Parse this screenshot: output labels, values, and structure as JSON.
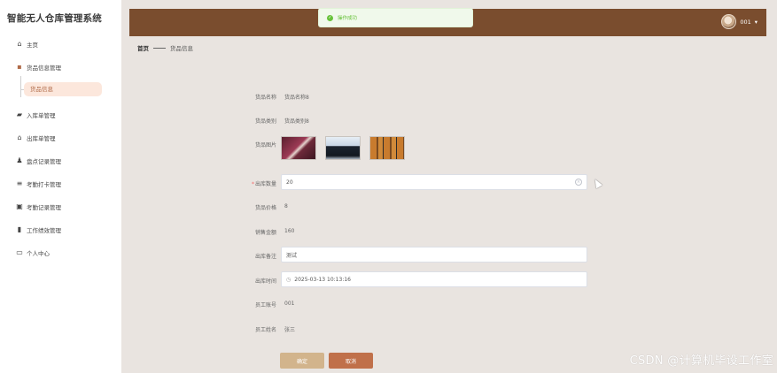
{
  "app": {
    "title": "智能无人仓库管理系统"
  },
  "sidebar": {
    "items": [
      {
        "label": "主页",
        "icon": "home-icon"
      },
      {
        "label": "货品信息管理",
        "icon": "grid-icon"
      },
      {
        "label": "货品信息",
        "icon": "",
        "active": true
      },
      {
        "label": "入库单管理",
        "icon": "truck-icon"
      },
      {
        "label": "出库单管理",
        "icon": "warehouse-icon"
      },
      {
        "label": "盘点记录管理",
        "icon": "person-icon"
      },
      {
        "label": "考勤打卡管理",
        "icon": "list-icon"
      },
      {
        "label": "考勤记录管理",
        "icon": "checkbox-icon"
      },
      {
        "label": "工作绩效管理",
        "icon": "chart-icon"
      },
      {
        "label": "个人中心",
        "icon": "card-icon"
      }
    ]
  },
  "topbar": {
    "toast": "操作成功",
    "user": "001",
    "accent": "#7a4d2e"
  },
  "breadcrumb": {
    "home": "首页",
    "current": "货品信息"
  },
  "form": {
    "product_name_label": "货品名称",
    "product_name": "货品名称8",
    "product_category_label": "货品类别",
    "product_category": "货品类别8",
    "product_image_label": "货品图片",
    "out_quantity_label": "出库数量",
    "out_quantity": "20",
    "price_label": "货品价格",
    "price": "8",
    "amount_label": "销售金额",
    "amount": "160",
    "remark_label": "出库备注",
    "remark": "测试",
    "time_label": "出库时间",
    "time": "2025-03-13 10:13:16",
    "staff_no_label": "员工账号",
    "staff_no": "001",
    "staff_name_label": "员工姓名",
    "staff_name": "张三"
  },
  "buttons": {
    "confirm": "确定",
    "cancel": "取消"
  },
  "watermark": "CSDN @计算机毕设工作室"
}
